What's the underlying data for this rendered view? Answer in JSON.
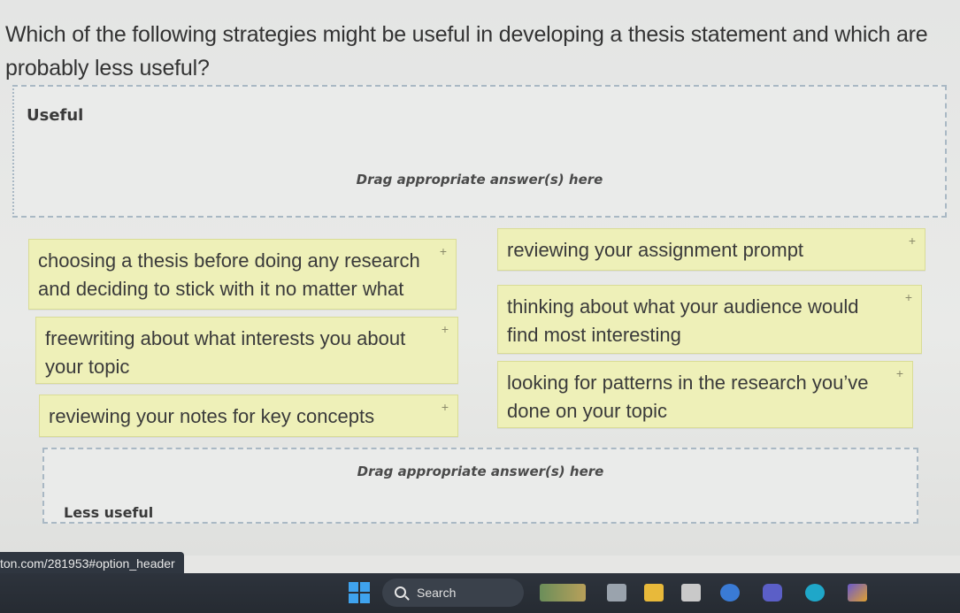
{
  "question": {
    "text": "Which of the following strategies might be useful in developing a thesis statement and which are probably less useful?"
  },
  "zones": {
    "useful": {
      "title": "Useful",
      "hint": "Drag appropriate answer(s) here"
    },
    "less_useful": {
      "title": "Less useful",
      "hint": "Drag appropriate answer(s) here"
    }
  },
  "cards": [
    {
      "text": "choosing a thesis before doing any research and deciding to stick with it no matter what",
      "icon": "drag-plus-icon"
    },
    {
      "text": "freewriting about what interests you about your topic",
      "icon": "drag-plus-icon"
    },
    {
      "text": "reviewing your notes for key concepts",
      "icon": "drag-plus-icon"
    },
    {
      "text": "reviewing your assignment prompt",
      "icon": "drag-plus-icon"
    },
    {
      "text": "thinking about what your audience would find most interesting",
      "icon": "drag-plus-icon"
    },
    {
      "text": "looking for patterns in the research you’ve done on your topic",
      "icon": "drag-plus-icon"
    }
  ],
  "plus_glyph": "+",
  "status_url": "ton.com/281953#option_header",
  "taskbar": {
    "search_label": "Search"
  },
  "colors": {
    "card_bg": "#eef0b8",
    "dropzone_border": "#a9b8c4",
    "taskbar_bg": "#2d333c",
    "windows_blue": "#3fa3ee"
  }
}
